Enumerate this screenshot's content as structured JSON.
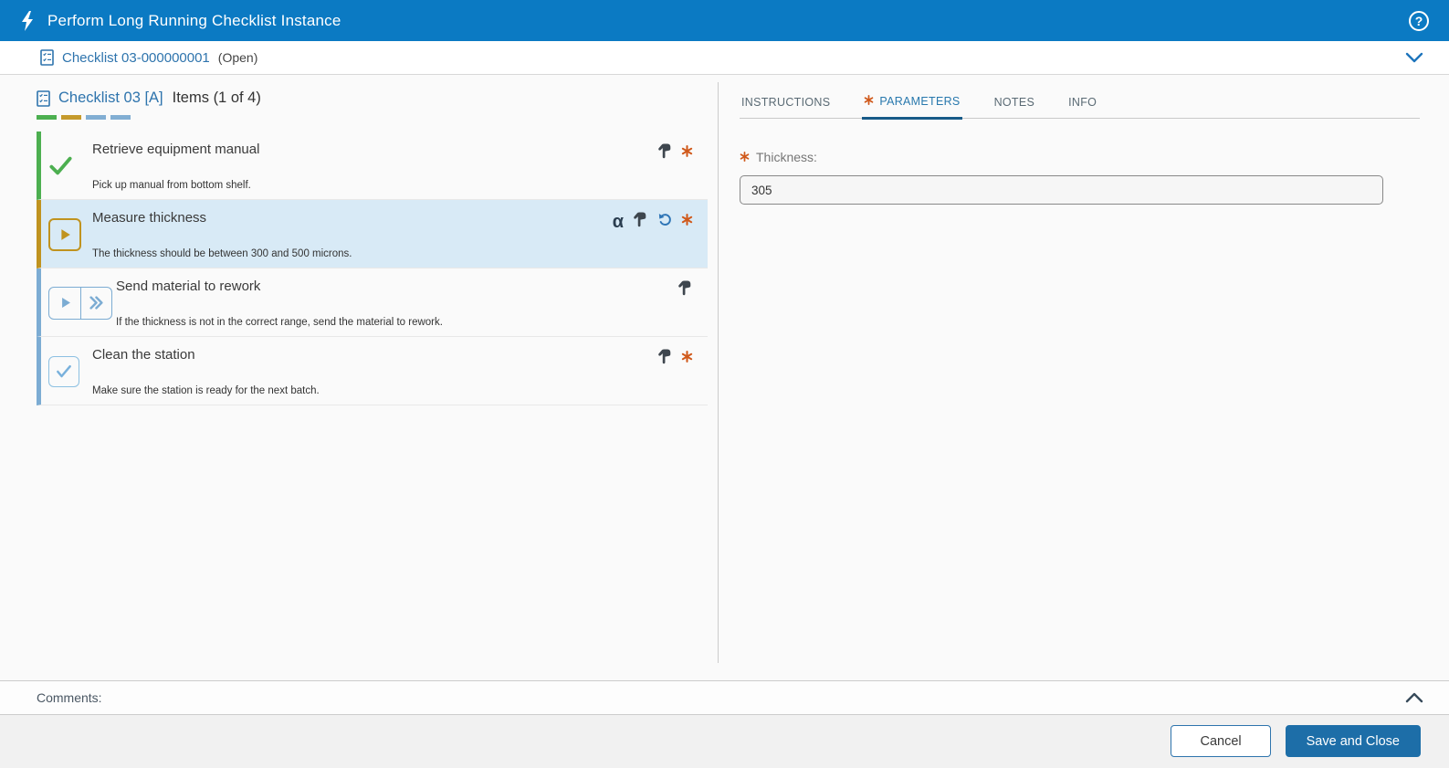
{
  "titlebar": {
    "title": "Perform Long Running Checklist Instance",
    "help_glyph": "?"
  },
  "breadcrumb": {
    "link": "Checklist 03-000000001",
    "status": "(Open)"
  },
  "left_panel": {
    "title": "Checklist 03 [A]",
    "items_counter": "Items (1 of 4)",
    "progress_segments": [
      {
        "state": "completed",
        "color": "#4caf50"
      },
      {
        "state": "in-progress",
        "color": "#c59a2c"
      },
      {
        "state": "pending",
        "color": "#82aed3"
      },
      {
        "state": "pending",
        "color": "#82aed3"
      }
    ],
    "items": [
      {
        "title": "Retrieve equipment manual",
        "description": "Pick up manual from bottom shelf.",
        "status": "completed",
        "required": true,
        "icons": [
          "check-icon",
          "manual-hand-icon",
          "required-asterisk-icon"
        ]
      },
      {
        "title": "Measure thickness",
        "description": "The thickness should be between 300 and 500 microns.",
        "status": "in-progress",
        "selected": true,
        "required": true,
        "alpha_glyph": "α",
        "icons": [
          "play-icon",
          "alpha-data-icon",
          "manual-hand-icon",
          "undo-icon",
          "required-asterisk-icon"
        ]
      },
      {
        "title": "Send material to rework",
        "description": "If the thickness is not in the correct range, send the material to rework.",
        "status": "pending",
        "required": false,
        "icons": [
          "play-icon",
          "skip-icon",
          "manual-hand-icon"
        ]
      },
      {
        "title": "Clean the station",
        "description": "Make sure the station is ready for the next batch.",
        "status": "pending",
        "required": true,
        "icons": [
          "checkbox-icon",
          "manual-hand-icon",
          "required-asterisk-icon"
        ]
      }
    ]
  },
  "right_panel": {
    "tabs": [
      {
        "label": "INSTRUCTIONS",
        "active": false,
        "required": false
      },
      {
        "label": "PARAMETERS",
        "active": true,
        "required": true
      },
      {
        "label": "NOTES",
        "active": false,
        "required": false
      },
      {
        "label": "INFO",
        "active": false,
        "required": false
      }
    ],
    "parameters": {
      "label": "Thickness:",
      "required": true,
      "value": "305"
    }
  },
  "comments": {
    "label": "Comments:"
  },
  "footer": {
    "cancel_label": "Cancel",
    "save_label": "Save and Close"
  },
  "colors": {
    "header_bg": "#0b7ac3",
    "accent_blue": "#2e74ad",
    "active_tab": "#2878ad",
    "active_tab_underline": "#175a88",
    "selected_item_bg": "#d8eaf6",
    "required_orange": "#d0591b",
    "done_green": "#4caf50",
    "running_gold": "#c0931f",
    "pending_blue": "#7cacd3",
    "save_button_bg": "#1d6ea8"
  }
}
